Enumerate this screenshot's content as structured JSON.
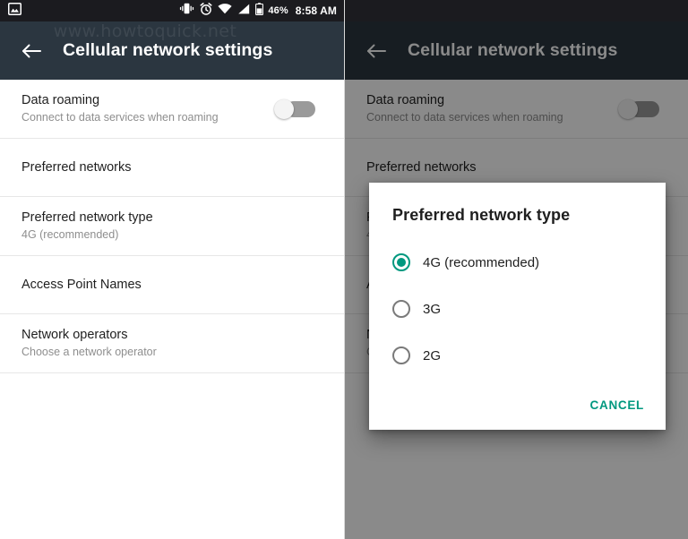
{
  "status_bar": {
    "left_icons": [
      {
        "name": "screenshot-icon",
        "label": "screenshot"
      }
    ],
    "right_icons": [
      {
        "name": "vibrate-icon",
        "label": "vibrate"
      },
      {
        "name": "alarm-icon",
        "label": "alarm"
      },
      {
        "name": "wifi-icon",
        "label": "wifi"
      },
      {
        "name": "signal-icon",
        "label": "cellular signal"
      },
      {
        "name": "battery-icon",
        "label": "battery"
      }
    ],
    "battery_percent": "46%",
    "clock": "8:58 AM"
  },
  "toolbar": {
    "back_icon": "arrow-left-icon",
    "title": "Cellular network settings"
  },
  "watermark": {
    "text": "www.howtoquick.net"
  },
  "settings_list": {
    "items": [
      {
        "title": "Data roaming",
        "subtitle": "Connect to data services when roaming",
        "control": "switch",
        "switch_state": "off"
      },
      {
        "title": "Preferred networks",
        "subtitle": "",
        "control": "none"
      },
      {
        "title": "Preferred network type",
        "subtitle": "4G (recommended)",
        "control": "none"
      },
      {
        "title": "Access Point Names",
        "subtitle": "",
        "control": "none"
      },
      {
        "title": "Network operators",
        "subtitle": "Choose a network operator",
        "control": "none"
      }
    ]
  },
  "dialog": {
    "title": "Preferred network type",
    "options": [
      {
        "label": "4G (recommended)",
        "selected": true
      },
      {
        "label": "3G",
        "selected": false
      },
      {
        "label": "2G",
        "selected": false
      }
    ],
    "cancel_label": "CANCEL"
  },
  "colors": {
    "status_bar_bg": "#1b1b1f",
    "toolbar_bg": "#2b3640",
    "accent_teal": "#00987f",
    "list_title": "#1f1f1f",
    "list_subtitle": "#8e8e8e",
    "divider": "#e7e7e7",
    "scrim": "rgba(0,0,0,0.46)"
  }
}
